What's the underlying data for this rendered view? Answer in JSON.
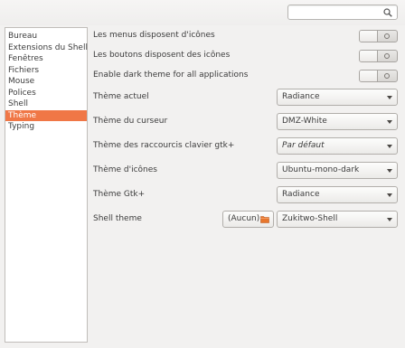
{
  "search": {
    "placeholder": ""
  },
  "sidebar": {
    "items": [
      {
        "label": "Bureau"
      },
      {
        "label": "Extensions du Shell"
      },
      {
        "label": "Fenêtres"
      },
      {
        "label": "Fichiers"
      },
      {
        "label": "Mouse"
      },
      {
        "label": "Polices"
      },
      {
        "label": "Shell"
      },
      {
        "label": "Thème",
        "selected": true
      },
      {
        "label": "Typing"
      }
    ]
  },
  "settings": {
    "menu_icons": {
      "label": "Les menus disposent d'icônes",
      "state": "off"
    },
    "button_icons": {
      "label": "Les boutons disposent des icônes",
      "state": "off"
    },
    "dark_theme": {
      "label": "Enable dark theme for all applications",
      "state": "off"
    },
    "current_theme": {
      "label": "Thème actuel",
      "value": "Radiance"
    },
    "cursor_theme": {
      "label": "Thème du curseur",
      "value": "DMZ-White"
    },
    "keybinding_theme": {
      "label": "Thème des raccourcis clavier gtk+",
      "value": "Par défaut"
    },
    "icon_theme": {
      "label": "Thème d'icônes",
      "value": "Ubuntu-mono-dark"
    },
    "gtk_theme": {
      "label": "Thème Gtk+",
      "value": "Radiance"
    },
    "shell_theme": {
      "label": "Shell theme",
      "file_button": "(Aucun)",
      "value": "Zukitwo-Shell"
    }
  },
  "colors": {
    "selection": "#f07746",
    "background": "#f2f1f0",
    "folder_icon": "#e8762c"
  }
}
